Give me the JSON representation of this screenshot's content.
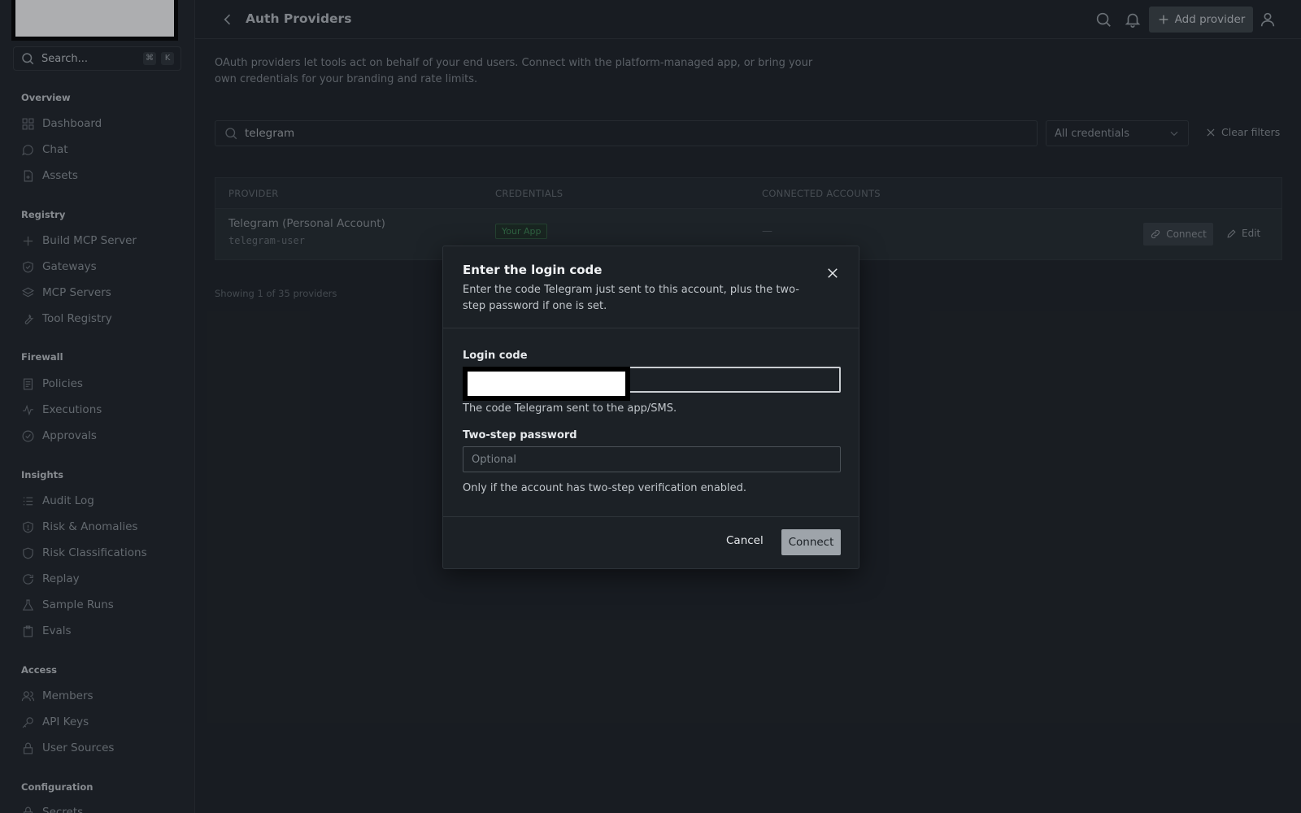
{
  "sidebar": {
    "search": {
      "placeholder": "Search...",
      "kbd1": "⌘",
      "kbd2": "K"
    },
    "sections": {
      "overview": "Overview",
      "registry": "Registry",
      "firewall": "Firewall",
      "insights": "Insights",
      "access": "Access",
      "configuration": "Configuration"
    },
    "items": {
      "dashboard": "Dashboard",
      "chat": "Chat",
      "assets": "Assets",
      "build_mcp": "Build MCP Server",
      "gateways": "Gateways",
      "mcp_servers": "MCP Servers",
      "tool_registry": "Tool Registry",
      "policies": "Policies",
      "executions": "Executions",
      "approvals": "Approvals",
      "audit_log": "Audit Log",
      "risk_anomalies": "Risk & Anomalies",
      "risk_classifications": "Risk Classifications",
      "replay": "Replay",
      "sample_runs": "Sample Runs",
      "evals": "Evals",
      "members": "Members",
      "api_keys": "API Keys",
      "user_sources": "User Sources",
      "secrets": "Secrets"
    }
  },
  "header": {
    "title": "Auth Providers",
    "add_provider": "Add provider"
  },
  "main": {
    "description": "OAuth providers let tools act on behalf of your end users. Connect with the platform-managed app, or bring your own credentials for your branding and rate limits.",
    "search_value": "telegram",
    "credentials_filter": "All credentials",
    "clear_filters": "Clear filters",
    "table": {
      "headers": [
        "PROVIDER",
        "CREDENTIALS",
        "CONNECTED ACCOUNTS"
      ],
      "row": {
        "name": "Telegram (Personal Account)",
        "slug": "telegram-user",
        "badge": "Your App",
        "accounts": "—",
        "connect": "Connect",
        "edit": "Edit"
      }
    },
    "showing": "Showing 1 of 35 providers"
  },
  "modal": {
    "title": "Enter the login code",
    "description": "Enter the code Telegram just sent to this account, plus the two-step password if one is set.",
    "login_label": "Login code",
    "login_hint": "The code Telegram sent to the app/SMS.",
    "password_label": "Two-step password",
    "password_placeholder": "Optional",
    "password_hint": "Only if the account has two-step verification enabled.",
    "cancel": "Cancel",
    "connect": "Connect"
  },
  "colors": {
    "background": "#1b2025",
    "badge_green": "#3d8a55",
    "primary_button": "#9ea4aa"
  }
}
